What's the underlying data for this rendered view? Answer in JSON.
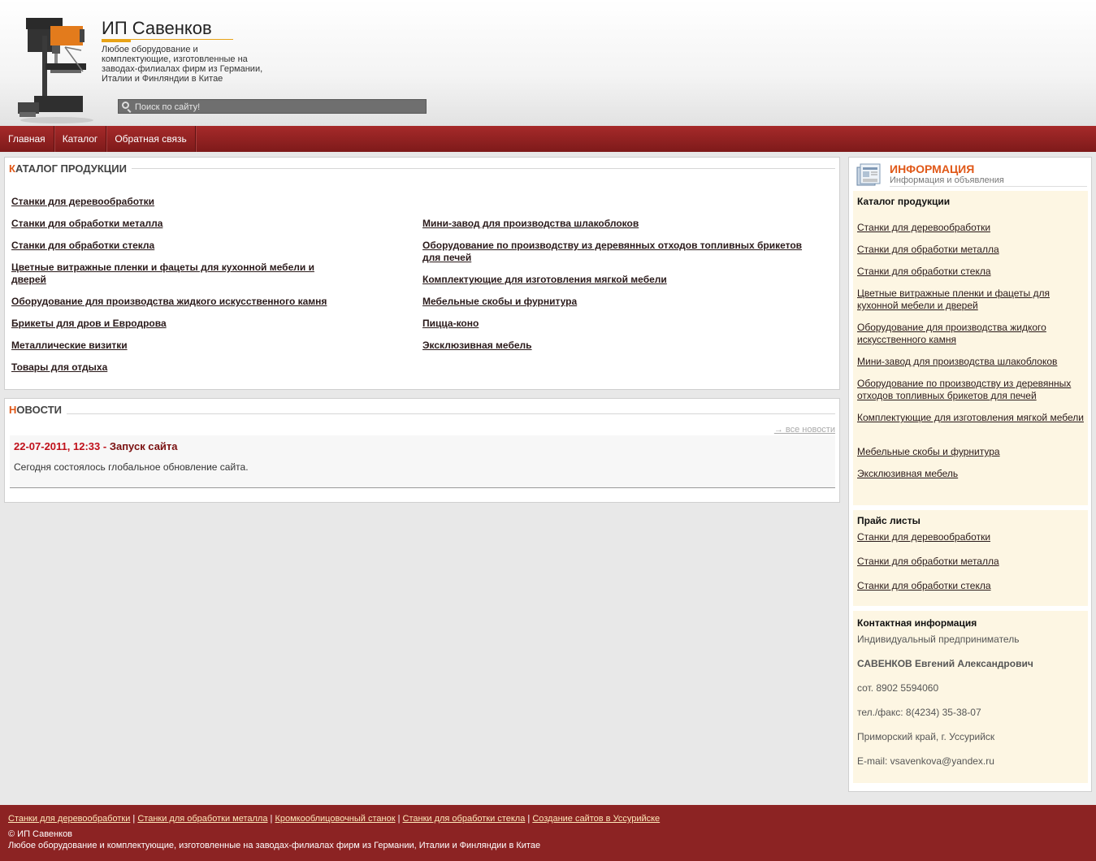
{
  "header": {
    "title": "ИП Савенков",
    "description": "Любое оборудование и комплектующие, изготовленные на заводах-филиалах фирм из Германии, Италии и Финляндии в Китае",
    "search_placeholder": "Поиск по сайту!"
  },
  "nav": {
    "items": [
      "Главная",
      "Каталог",
      "Обратная связь"
    ]
  },
  "catalog": {
    "title_first": "К",
    "title_rest": "АТАЛОГ ПРОДУКЦИИ",
    "left": [
      "Станки для деревообработки",
      "Станки для обработки металла",
      "Станки для обработки стекла",
      "Цветные витражные пленки и фацеты для кухонной мебели и дверей",
      "Оборудование для производства жидкого искусственного камня",
      "Брикеты для дров и Евродрова",
      "Металлические визитки",
      "Товары для отдыха"
    ],
    "right": [
      "Мини-завод для производства шлакоблоков",
      "Оборудование по производству из деревянных отходов топливных брикетов для печей",
      "Комплектующие для изготовления мягкой мебели",
      "Мебельные скобы и фурнитура",
      "Пицца-коно",
      "Эксклюзивная мебель"
    ]
  },
  "news": {
    "title_first": "Н",
    "title_rest": "ОВОСТИ",
    "all_link": "→ все новости",
    "item": {
      "date": "22-07-2011, 12:33",
      "separator": " - ",
      "title": "Запуск сайта",
      "text": "Сегодня состоялось глобальное обновление сайта."
    }
  },
  "sidebar": {
    "title": "ИНФОРМАЦИЯ",
    "subtitle": "Информация и объявления",
    "catalog_title": "Каталог продукции",
    "catalog_links": [
      "Станки для деревообработки",
      "Станки для обработки металла",
      "Станки для обработки стекла",
      "Цветные витражные пленки и фацеты для кухонной мебели и дверей",
      "Оборудование для производства жидкого искусственного камня",
      "Мини-завод для производства шлакоблоков",
      "Оборудование по производству из деревянных отходов топливных брикетов для печей",
      "Комплектующие для изготовления мягкой мебели",
      "Мебельные скобы и фурнитура",
      "Эксклюзивная мебель"
    ],
    "price_title": "Прайс листы",
    "price_links": [
      "Станки для деревообработки",
      "Станки для обработки металла",
      "Станки для обработки стекла"
    ],
    "contact_title": "Контактная информация",
    "contact_lines": [
      "Индивидуальный предприниматель",
      "САВЕНКОВ Евгений Александрович",
      "сот. 8902 5594060",
      "тел./факс: 8(4234) 35-38-07",
      "Приморский край, г. Уссурийск",
      "E-mail: vsavenkova@yandex.ru"
    ]
  },
  "footer": {
    "links": [
      "Станки для деревообработки",
      "Станки для обработки металла",
      "Кромкооблицовочный станок",
      "Станки для обработки стекла",
      "Создание сайтов в Уссурийске"
    ],
    "separator": " | ",
    "copyright": "© ИП Савенков",
    "description": "Любое оборудование и комплектующие, изготовленные на заводах-филиалах фирм из Германии, Италии и Финляндии в Китае"
  }
}
